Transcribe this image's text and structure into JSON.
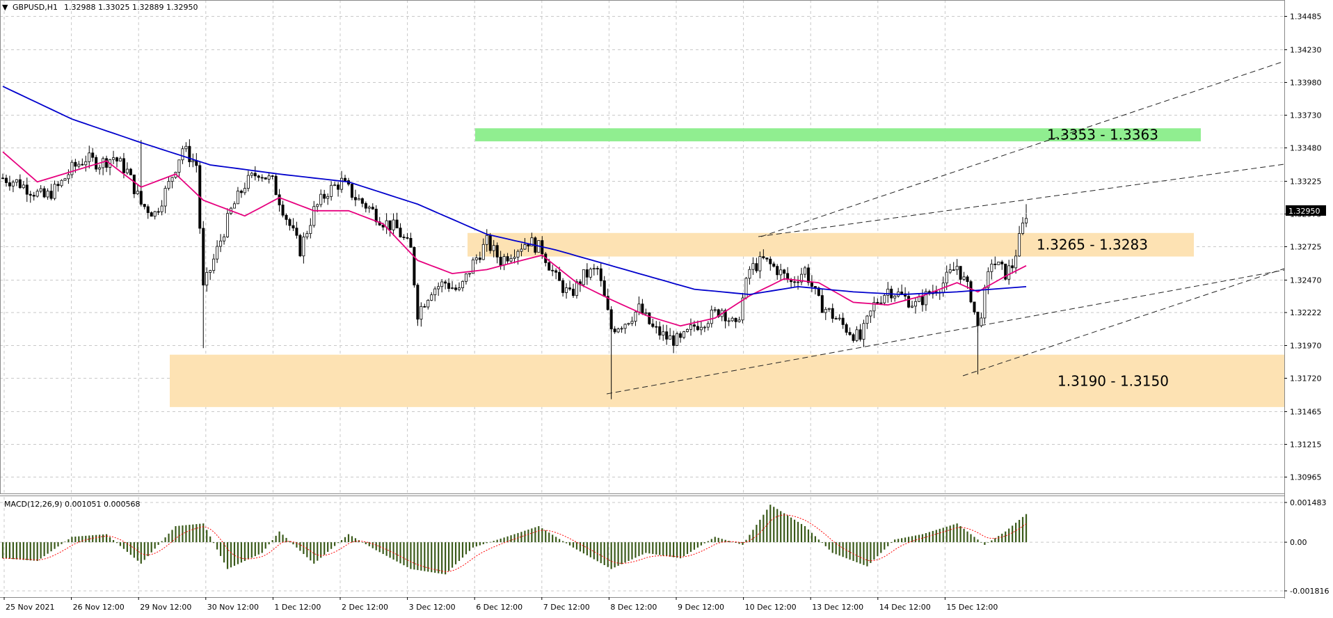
{
  "header": {
    "symbol": "GBPUSD,H1",
    "ohlc": "1.32988 1.33025 1.32889 1.32950",
    "menu_glyph": "▼"
  },
  "price_axis": {
    "ticks": [
      "1.34485",
      "1.34230",
      "1.33980",
      "1.33730",
      "1.33480",
      "1.33225",
      "1.32975",
      "1.32725",
      "1.32470",
      "1.32222",
      "1.31970",
      "1.31720",
      "1.31465",
      "1.31215",
      "1.30965"
    ],
    "current_price": "1.32950"
  },
  "macd": {
    "label": "MACD(12,26,9) 0.001051 0.000568",
    "ticks": [
      "0.001483",
      "0.00",
      "-0.001816"
    ]
  },
  "time_axis": {
    "labels": [
      "25 Nov 2021",
      "26 Nov 12:00",
      "29 Nov 12:00",
      "30 Nov 12:00",
      "1 Dec 12:00",
      "2 Dec 12:00",
      "3 Dec 12:00",
      "6 Dec 12:00",
      "7 Dec 12:00",
      "8 Dec 12:00",
      "9 Dec 12:00",
      "10 Dec 12:00",
      "13 Dec 12:00",
      "14 Dec 12:00",
      "15 Dec 12:00"
    ]
  },
  "zones": [
    {
      "label": "1.3353 - 1.3363",
      "color": "#90ee90",
      "top": 1.3363,
      "bottom": 1.3353,
      "x0": "6 Dec 12:00",
      "x1": "right edge"
    },
    {
      "label": "1.3265 - 1.3283",
      "color": "#fde2b3",
      "top": 1.3283,
      "bottom": 1.3265,
      "x0": "6 Dec 12:00",
      "x1": "right edge"
    },
    {
      "label": "1.3190 - 1.3150",
      "color": "#fde2b3",
      "top": 1.319,
      "bottom": 1.315,
      "x0": "29 Nov 12:00",
      "x1": "right edge"
    }
  ],
  "colors": {
    "bull_candle": "#ffffff",
    "bear_candle": "#000000",
    "ma_fast": "#e6007e",
    "ma_slow": "#0000cc",
    "macd_hist": "#3a5a1a",
    "macd_signal": "#ff0000",
    "grid": "#c8c8c8"
  },
  "chart_data": {
    "type": "candlestick",
    "symbol": "GBPUSD",
    "timeframe": "H1",
    "y_range": [
      1.3084,
      1.3461
    ],
    "grid": true,
    "series": [
      {
        "name": "price",
        "points": [
          [
            0,
            1.3325
          ],
          [
            4,
            1.3322
          ],
          [
            8,
            1.3316
          ],
          [
            12,
            1.331
          ],
          [
            16,
            1.3318
          ],
          [
            20,
            1.3332
          ],
          [
            24,
            1.334
          ],
          [
            28,
            1.3336
          ],
          [
            32,
            1.3341
          ],
          [
            36,
            1.333
          ],
          [
            40,
            1.3305
          ],
          [
            44,
            1.3298
          ],
          [
            48,
            1.332
          ],
          [
            52,
            1.3348
          ],
          [
            56,
            1.3335
          ],
          [
            58,
            1.324
          ],
          [
            62,
            1.327
          ],
          [
            66,
            1.33
          ],
          [
            70,
            1.332
          ],
          [
            74,
            1.333
          ],
          [
            78,
            1.3322
          ],
          [
            82,
            1.3295
          ],
          [
            86,
            1.327
          ],
          [
            90,
            1.33
          ],
          [
            94,
            1.3315
          ],
          [
            98,
            1.3322
          ],
          [
            102,
            1.331
          ],
          [
            106,
            1.3302
          ],
          [
            110,
            1.3292
          ],
          [
            114,
            1.3286
          ],
          [
            118,
            1.327
          ],
          [
            120,
            1.3222
          ],
          [
            124,
            1.324
          ],
          [
            128,
            1.3245
          ],
          [
            132,
            1.3238
          ],
          [
            136,
            1.326
          ],
          [
            140,
            1.3276
          ],
          [
            144,
            1.3262
          ],
          [
            148,
            1.327
          ],
          [
            152,
            1.3277
          ],
          [
            156,
            1.327
          ],
          [
            160,
            1.3248
          ],
          [
            164,
            1.3235
          ],
          [
            168,
            1.325
          ],
          [
            172,
            1.3255
          ],
          [
            176,
            1.321
          ],
          [
            180,
            1.3215
          ],
          [
            184,
            1.3225
          ],
          [
            188,
            1.321
          ],
          [
            192,
            1.3203
          ],
          [
            196,
            1.32
          ],
          [
            200,
            1.3212
          ],
          [
            204,
            1.3218
          ],
          [
            208,
            1.3225
          ],
          [
            212,
            1.321
          ],
          [
            216,
            1.3255
          ],
          [
            220,
            1.3262
          ],
          [
            224,
            1.3255
          ],
          [
            228,
            1.3245
          ],
          [
            232,
            1.3255
          ],
          [
            236,
            1.323
          ],
          [
            240,
            1.322
          ],
          [
            244,
            1.321
          ],
          [
            248,
            1.3202
          ],
          [
            252,
            1.3228
          ],
          [
            256,
            1.324
          ],
          [
            260,
            1.3235
          ],
          [
            264,
            1.3228
          ],
          [
            268,
            1.3237
          ],
          [
            272,
            1.3245
          ],
          [
            276,
            1.3258
          ],
          [
            280,
            1.3235
          ],
          [
            282,
            1.321
          ],
          [
            286,
            1.3262
          ],
          [
            290,
            1.3252
          ],
          [
            292,
            1.3258
          ],
          [
            296,
            1.3298
          ]
        ]
      },
      {
        "name": "ma_fast",
        "points": [
          [
            0,
            1.3345
          ],
          [
            10,
            1.3322
          ],
          [
            20,
            1.333
          ],
          [
            30,
            1.3338
          ],
          [
            40,
            1.3318
          ],
          [
            50,
            1.3328
          ],
          [
            58,
            1.3308
          ],
          [
            70,
            1.3296
          ],
          [
            80,
            1.331
          ],
          [
            90,
            1.33
          ],
          [
            100,
            1.33
          ],
          [
            110,
            1.329
          ],
          [
            120,
            1.3262
          ],
          [
            130,
            1.3252
          ],
          [
            140,
            1.3255
          ],
          [
            150,
            1.3262
          ],
          [
            156,
            1.3266
          ],
          [
            166,
            1.3245
          ],
          [
            176,
            1.3232
          ],
          [
            186,
            1.322
          ],
          [
            196,
            1.3212
          ],
          [
            206,
            1.3218
          ],
          [
            216,
            1.3235
          ],
          [
            226,
            1.3248
          ],
          [
            236,
            1.3245
          ],
          [
            246,
            1.323
          ],
          [
            256,
            1.3228
          ],
          [
            266,
            1.3235
          ],
          [
            276,
            1.3245
          ],
          [
            282,
            1.3238
          ],
          [
            290,
            1.325
          ],
          [
            296,
            1.3258
          ]
        ]
      },
      {
        "name": "ma_slow",
        "points": [
          [
            0,
            1.3395
          ],
          [
            20,
            1.337
          ],
          [
            40,
            1.3352
          ],
          [
            60,
            1.3335
          ],
          [
            80,
            1.3328
          ],
          [
            100,
            1.3322
          ],
          [
            120,
            1.3305
          ],
          [
            140,
            1.3282
          ],
          [
            160,
            1.327
          ],
          [
            180,
            1.3255
          ],
          [
            200,
            1.324
          ],
          [
            216,
            1.3236
          ],
          [
            230,
            1.3242
          ],
          [
            246,
            1.3238
          ],
          [
            260,
            1.3236
          ],
          [
            276,
            1.3238
          ],
          [
            296,
            1.3242
          ]
        ]
      }
    ],
    "macd_series": [
      {
        "name": "histogram",
        "points": [
          [
            0,
            -0.0006
          ],
          [
            10,
            -0.0007
          ],
          [
            20,
            0.0002
          ],
          [
            30,
            0.0003
          ],
          [
            40,
            -0.0008
          ],
          [
            50,
            0.0006
          ],
          [
            58,
            0.0007
          ],
          [
            65,
            -0.001
          ],
          [
            75,
            -0.0004
          ],
          [
            80,
            0.0004
          ],
          [
            90,
            -0.0008
          ],
          [
            100,
            0.0003
          ],
          [
            108,
            -0.0003
          ],
          [
            118,
            -0.001
          ],
          [
            128,
            -0.0012
          ],
          [
            136,
            -0.0002
          ],
          [
            148,
            0.0003
          ],
          [
            155,
            0.0006
          ],
          [
            165,
            -0.0002
          ],
          [
            176,
            -0.001
          ],
          [
            186,
            -0.0004
          ],
          [
            196,
            -0.0006
          ],
          [
            206,
            0.0002
          ],
          [
            214,
            -0.0001
          ],
          [
            222,
            0.0014
          ],
          [
            232,
            0.0006
          ],
          [
            240,
            -0.0004
          ],
          [
            250,
            -0.0009
          ],
          [
            258,
            0.0001
          ],
          [
            266,
            0.0003
          ],
          [
            276,
            0.0007
          ],
          [
            284,
            -0.0001
          ],
          [
            290,
            0.0004
          ],
          [
            296,
            0.00105
          ]
        ]
      }
    ],
    "macd_ylim": [
      -0.001816,
      0.001483
    ]
  }
}
